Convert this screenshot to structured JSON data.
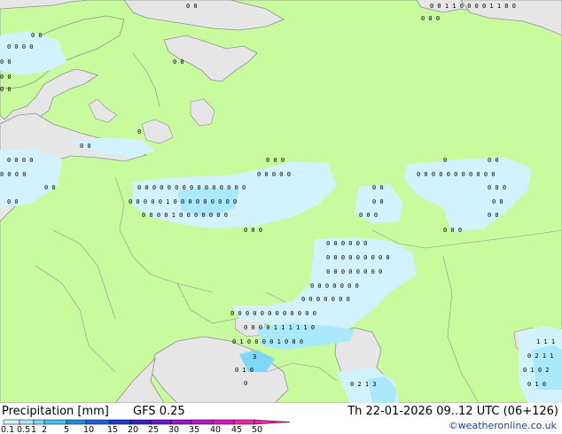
{
  "legend": {
    "title": "Precipitation [mm]",
    "model": "GFS 0.25",
    "valid": "Th 22-01-2026 09..12 UTC (06+126)",
    "credit": "©weatheronline.co.uk",
    "scale": [
      {
        "label": "0.1",
        "color": "#ffffff"
      },
      {
        "label": "0.5",
        "color": "#d2f2ff"
      },
      {
        "label": "1",
        "color": "#aae8fb"
      },
      {
        "label": "2",
        "color": "#7cd8f6"
      },
      {
        "label": "5",
        "color": "#42c2f0"
      },
      {
        "label": "10",
        "color": "#1e8be8"
      },
      {
        "label": "15",
        "color": "#1c5ee0"
      },
      {
        "label": "20",
        "color": "#1c3cd6"
      },
      {
        "label": "25",
        "color": "#3a1ccf"
      },
      {
        "label": "30",
        "color": "#6a18cf"
      },
      {
        "label": "35",
        "color": "#9a14cf"
      },
      {
        "label": "40",
        "color": "#c012cf"
      },
      {
        "label": "45",
        "color": "#e010c8"
      },
      {
        "label": "50",
        "color": "#f020a8"
      }
    ]
  },
  "colors": {
    "land": "#c8fa9e",
    "sea": "#e6e6e6",
    "border": "#909090",
    "precip_light": "#d2f2ff",
    "precip_mid": "#aae8fb",
    "precip_strong": "#7cd8f6"
  }
}
